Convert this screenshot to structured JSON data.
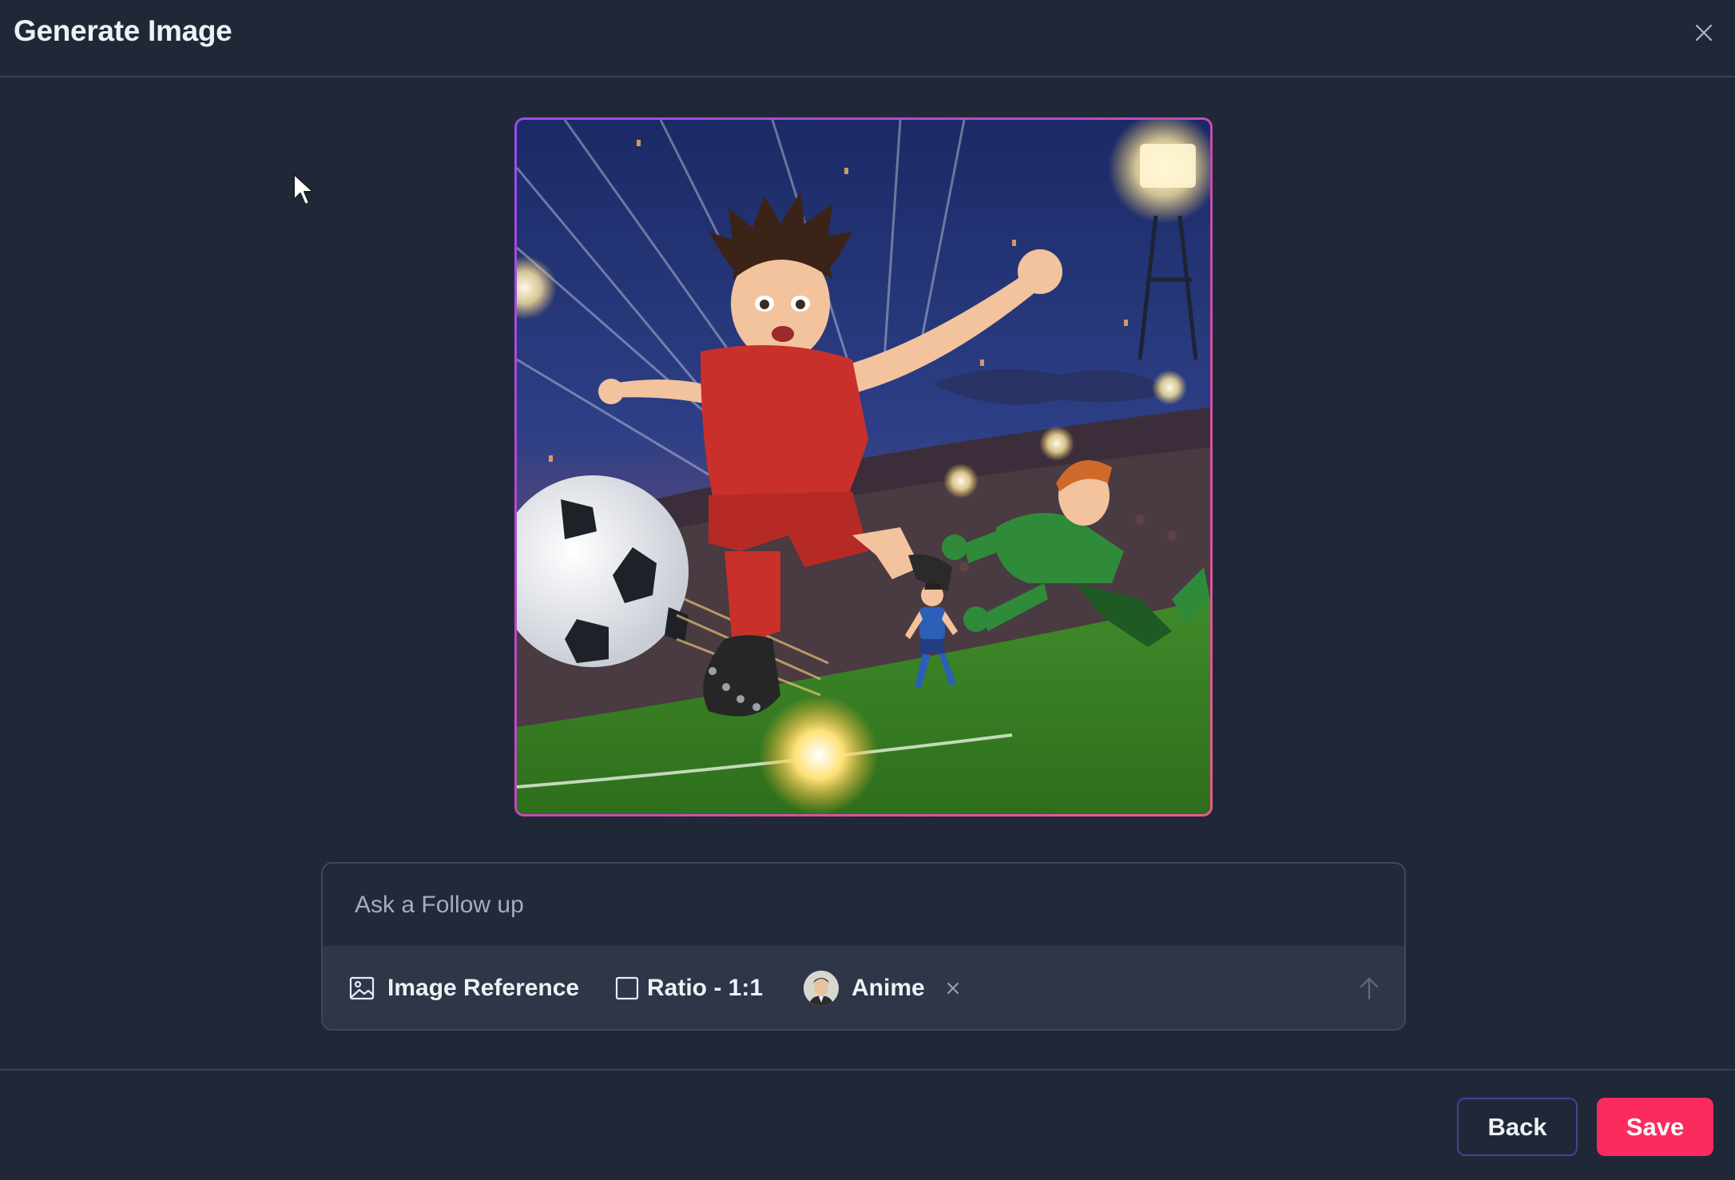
{
  "dialog": {
    "title": "Generate Image",
    "close_icon": "close-icon"
  },
  "generated_image": {
    "alt": "Anime style illustration of a soccer player in a red kit kicking a ball in a night stadium while a green goalkeeper dives"
  },
  "prompt": {
    "placeholder": "Ask a Follow up",
    "value": ""
  },
  "toolbar": {
    "image_reference_label": "Image Reference",
    "image_reference_icon": "image-icon",
    "ratio_label": "Ratio - 1:1",
    "ratio_icon": "square-icon",
    "style_label": "Anime",
    "style_remove_icon": "close-icon",
    "send_icon": "arrow-up-icon"
  },
  "footer": {
    "back_label": "Back",
    "save_label": "Save"
  },
  "colors": {
    "background": "#202838",
    "accent_save": "#fb2b5e",
    "back_border": "#4a3e9a",
    "image_border_start": "#9a4bf0",
    "image_border_end": "#ee5a8a"
  }
}
